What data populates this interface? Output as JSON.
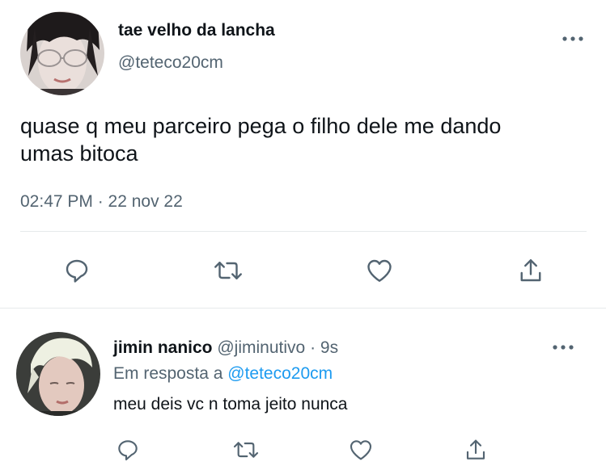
{
  "main_tweet": {
    "display_name": "tae velho da lancha",
    "handle": "@teteco20cm",
    "text_line1": "quase q meu parceiro pega o filho dele me dando",
    "text_line2": "umas bitoca",
    "timestamp": "02:47 PM · 22 nov 22",
    "more_icon": "more-horizontal-icon",
    "actions": [
      "reply-icon",
      "retweet-icon",
      "like-icon",
      "share-icon"
    ]
  },
  "reply_tweet": {
    "display_name": "jimin nanico",
    "handle": "@jiminutivo",
    "separator": "·",
    "time_ago": "9s",
    "reply_prefix": "Em resposta a",
    "reply_to": "@teteco20cm",
    "text": "meu deis vc n toma jeito nunca",
    "more_icon": "more-horizontal-icon",
    "actions": [
      "reply-icon",
      "retweet-icon",
      "like-icon",
      "share-icon"
    ]
  },
  "colors": {
    "text": "#0f1419",
    "muted": "#536471",
    "link": "#1d9bf0",
    "divider": "#e6e9eb",
    "icon": "#536471"
  }
}
